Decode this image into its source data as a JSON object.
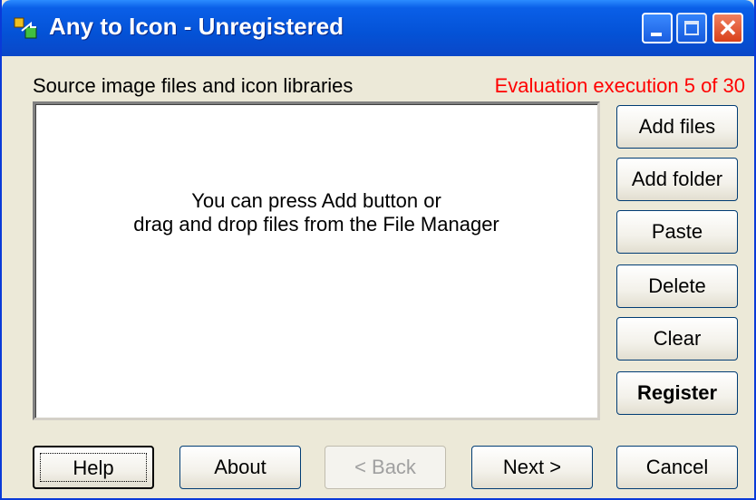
{
  "window": {
    "title": "Any to Icon - Unregistered"
  },
  "labels": {
    "source": "Source image files and icon libraries",
    "evaluation": "Evaluation execution 5 of 30"
  },
  "listbox": {
    "hint_line1": "You can press Add button or",
    "hint_line2": "drag and drop files from the File Manager"
  },
  "side_buttons": {
    "add_files": "Add files",
    "add_folder": "Add folder",
    "paste": "Paste",
    "delete": "Delete",
    "clear": "Clear",
    "register": "Register"
  },
  "bottom_buttons": {
    "help": "Help",
    "about": "About",
    "back": "< Back",
    "next": "Next >",
    "cancel": "Cancel"
  },
  "colors": {
    "title_bar": "#0452d6",
    "evaluation_text": "#ff0000",
    "window_bg": "#ece9d8"
  }
}
